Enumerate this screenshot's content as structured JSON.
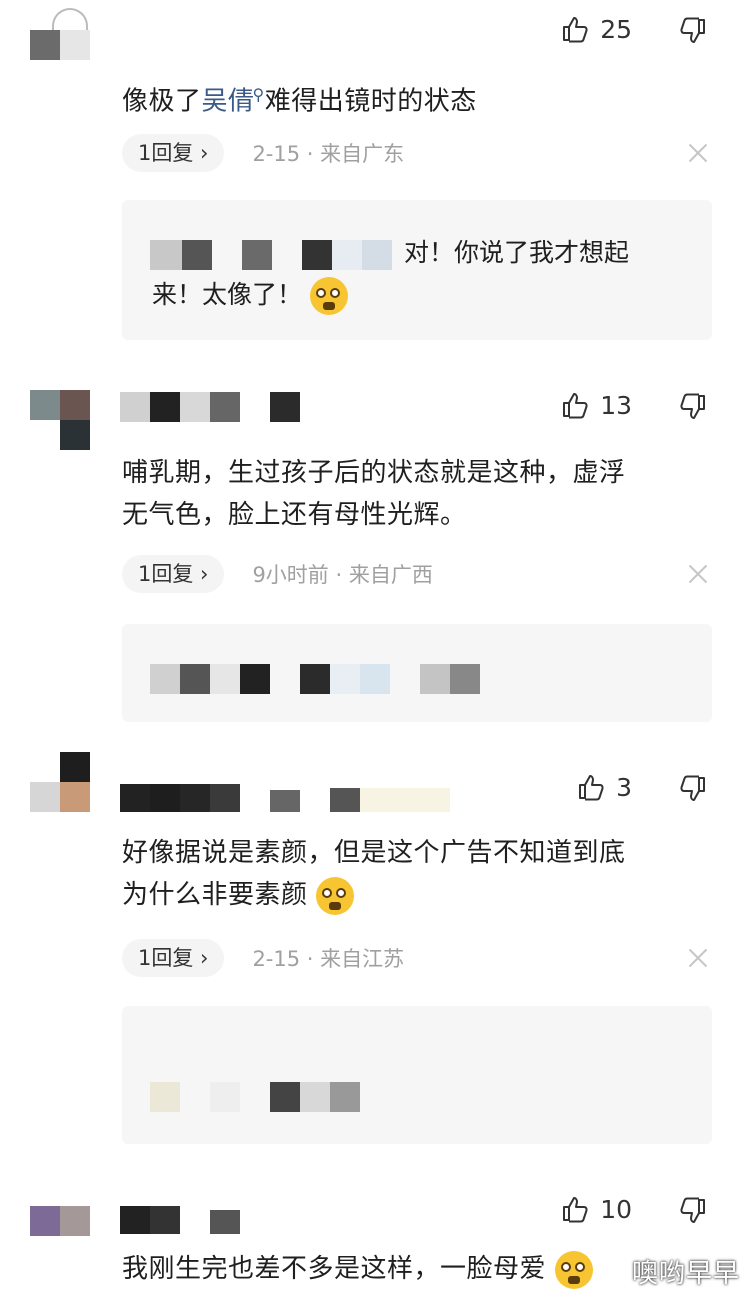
{
  "comments": [
    {
      "likes": "25",
      "text_before": "像极了",
      "text_link": "吴倩",
      "text_after": "难得出镜时的状态",
      "reply_label": "1回复 ›",
      "meta": "2-15 · 来自广东",
      "reply_text_line1": "对！你说了我才想起",
      "reply_text_line2": "来！太像了！"
    },
    {
      "likes": "13",
      "text_line1": "哺乳期，生过孩子后的状态就是这种，虚浮",
      "text_line2": "无气色，脸上还有母性光辉。",
      "reply_label": "1回复 ›",
      "meta": "9小时前 · 来自广西"
    },
    {
      "likes": "3",
      "text_line1": "好像据说是素颜，但是这个广告不知道到底",
      "text_line2": "为什么非要素颜",
      "reply_label": "1回复 ›",
      "meta": "2-15 · 来自江苏"
    },
    {
      "likes": "10",
      "text_line1": "我刚生完也差不多是这样，一脸母爱"
    }
  ],
  "watermark": "噢哟早早",
  "icons": {
    "like": "thumbs-up-icon",
    "dislike": "thumbs-down-icon",
    "close": "close-icon",
    "search": "search-icon",
    "emoji": "emoji-icon"
  },
  "colors": {
    "link": "#3a5a8a",
    "meta": "#a0a0a0",
    "reply_bg": "#f6f6f6"
  }
}
